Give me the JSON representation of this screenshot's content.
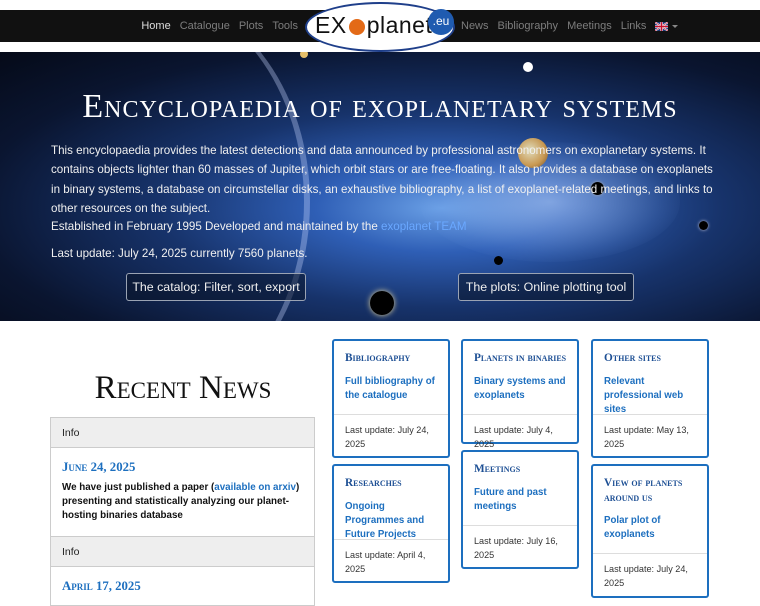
{
  "nav": {
    "left": [
      "Home",
      "Catalogue",
      "Plots",
      "Tools"
    ],
    "right": [
      "News",
      "Bibliography",
      "Meetings",
      "Links"
    ]
  },
  "logo": {
    "text_a": "EX",
    "text_b": "planet",
    "badge": ".eu"
  },
  "hero": {
    "title": "Encyclopaedia of exoplanetary systems",
    "description": "This encyclopaedia provides the latest detections and data announced by professional astronomers on exoplanetary systems. It contains objects lighter than 60 masses of Jupiter, which orbit stars or are free-floating. It also provides a database on exoplanets in binary systems, a database on circumstellar disks, an exhaustive bibliography, a list of exoplanet-related meetings, and links to other resources on the subject.",
    "established": "Established in February 1995 Developed and maintained by the",
    "team_link": "exoplanet TEAM",
    "last_update": "Last update: July 24, 2025 currently 7560 planets.",
    "btn_catalog": "The catalog: Filter, sort, export",
    "btn_plots": "The plots: Online plotting tool"
  },
  "news": {
    "title": "Recent News",
    "items": [
      {
        "head": "Info",
        "date": "June 24, 2025",
        "text_a": "We have just published a paper (",
        "link": "available on arxiv",
        "text_b": ") presenting and statistically analyzing our planet-hosting binaries database"
      },
      {
        "head": "Info",
        "date": "April 17, 2025"
      }
    ]
  },
  "cards": [
    {
      "title": "Bibliography",
      "link": "Full bibliography of the catalogue",
      "foot": "Last update: July 24, 2025"
    },
    {
      "title": "Planets in binaries",
      "link": "Binary systems and exoplanets",
      "foot": "Last update: July 4, 2025"
    },
    {
      "title": "Other sites",
      "link": "Relevant professional web sites",
      "foot": "Last update: May 13, 2025"
    },
    {
      "title": "Researches",
      "link": "Ongoing Programmes and Future Projects",
      "foot": "Last update: April 4, 2025"
    },
    {
      "title": "Meetings",
      "link": "Future and past meetings",
      "foot": "Last update: July 16, 2025"
    },
    {
      "title": "View of planets around us",
      "link": "Polar plot of exoplanets",
      "foot": "Last update: July 24, 2025"
    }
  ],
  "colors": {
    "accent": "#1d6fbf",
    "navbar": "#111111"
  },
  "icons": {
    "language": "uk-flag-icon"
  }
}
